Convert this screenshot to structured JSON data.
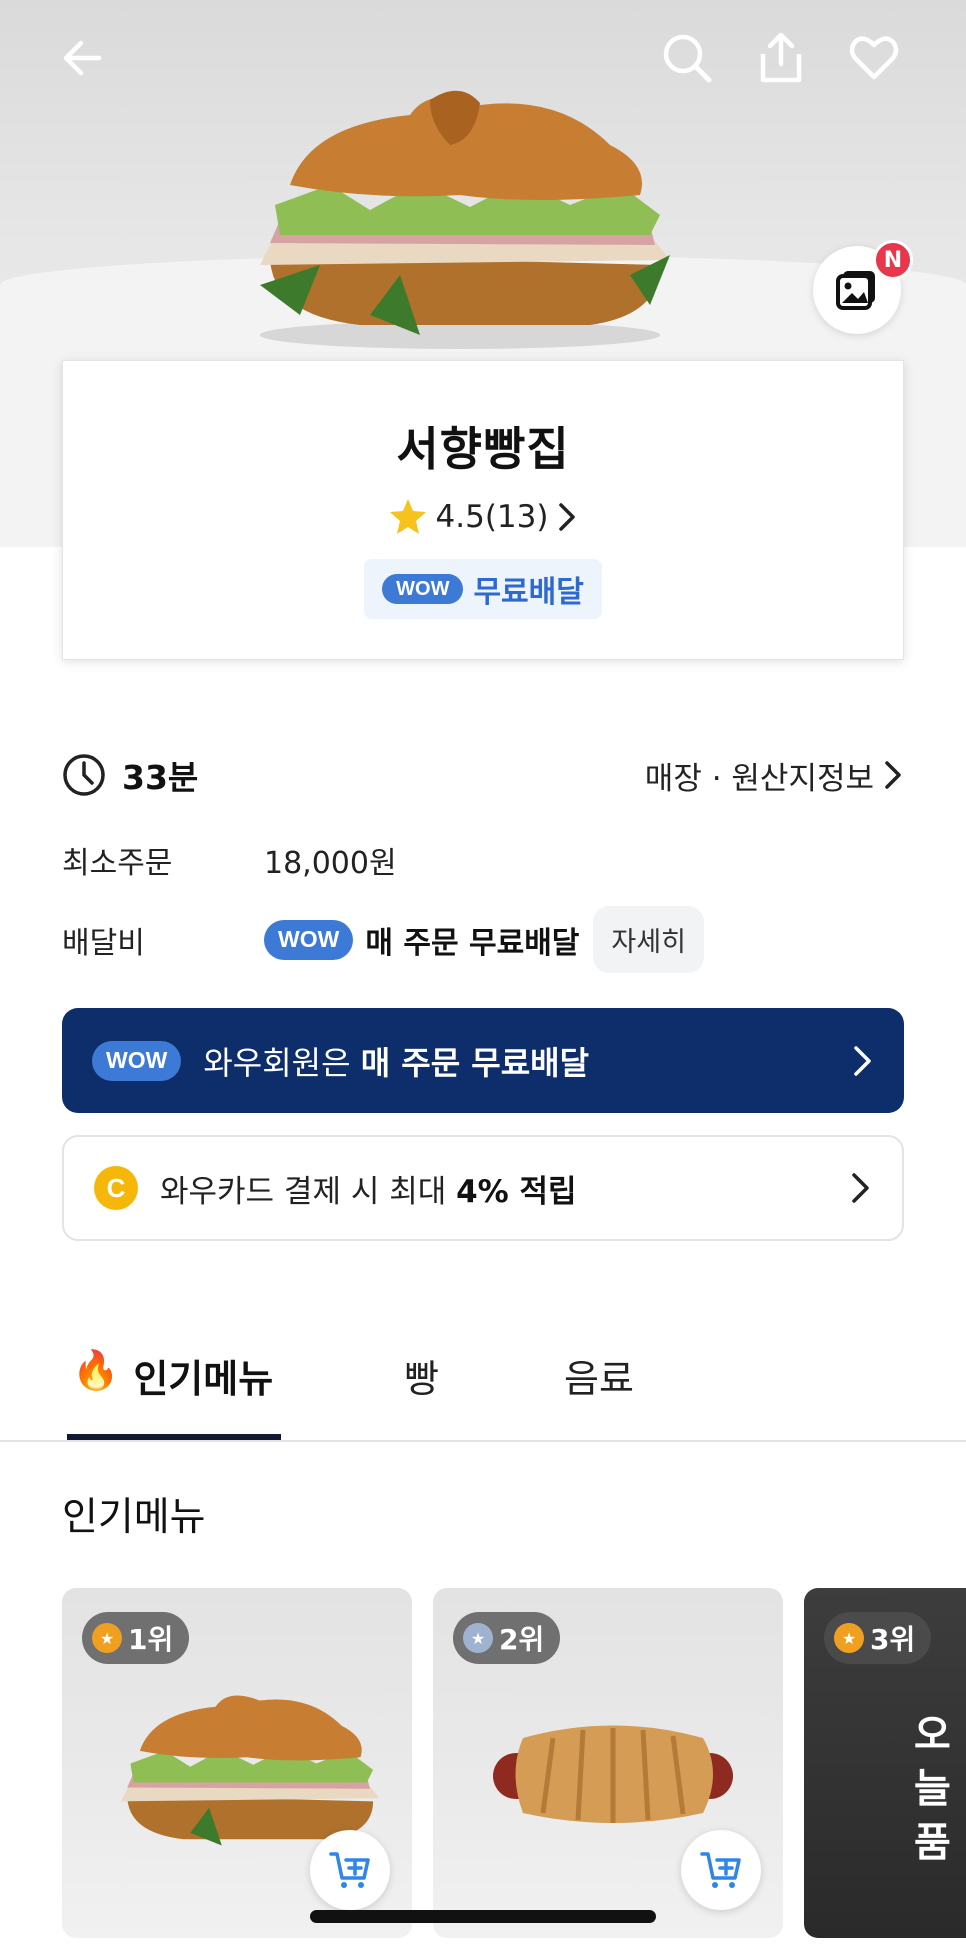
{
  "store": {
    "name": "서향빵집",
    "rating": "4.5(13)",
    "wow_label": "WOW",
    "free_delivery": "무료배달"
  },
  "info": {
    "time": "33분",
    "store_info_link": "매장 · 원산지정보",
    "min_order_label": "최소주문",
    "min_order_value": "18,000원",
    "delivery_fee_label": "배달비",
    "delivery_fee_value": "매 주문 무료배달",
    "detail_button": "자세히"
  },
  "banners": {
    "wow_prefix": "와우회원은 ",
    "wow_bold": "매 주문 무료배달",
    "card_prefix": "와우카드 결제 시 최대 ",
    "card_bold": "4% 적립",
    "coin_letter": "C"
  },
  "tabs": [
    {
      "label": "인기메뉴",
      "emoji": "🔥"
    },
    {
      "label": "빵"
    },
    {
      "label": "음료"
    }
  ],
  "section_title": "인기메뉴",
  "menu_cards": [
    {
      "rank": "1위",
      "medal_color": "#f0a020"
    },
    {
      "rank": "2위",
      "medal_color": "#9fb3d1"
    },
    {
      "rank": "3위",
      "medal_color": "#f0a020",
      "overlay_text_line1": "오늘",
      "overlay_text_line2": "품"
    }
  ],
  "gallery_badge": "N",
  "colors": {
    "wow_blue": "#3d7ad6",
    "wow_banner": "#0e2d6b",
    "coin": "#f5b80a",
    "badge_red": "#e8364b"
  },
  "icons": [
    "back-arrow-icon",
    "search-icon",
    "share-icon",
    "heart-icon",
    "gallery-icon",
    "star-icon",
    "chevron-right-icon",
    "clock-icon",
    "fire-icon",
    "medal-icon",
    "add-cart-icon"
  ]
}
